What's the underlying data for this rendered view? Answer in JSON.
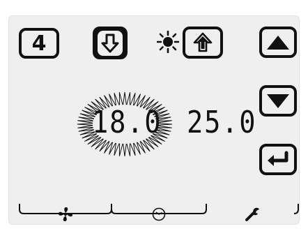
{
  "zone": {
    "number": "4"
  },
  "modes": {
    "heat_icon": "down-arrow-icon",
    "sun_icon": "sun-icon",
    "cool_icon": "up-arrow-icon"
  },
  "temperatures": {
    "setpoint_active": "18.0",
    "setpoint_other": "25.0"
  },
  "buttons": {
    "up_icon": "triangle-up-icon",
    "down_icon": "triangle-down-icon",
    "enter_icon": "enter-arrow-icon"
  },
  "tabs": [
    {
      "id": "fan",
      "icon": "fan-icon",
      "active": false
    },
    {
      "id": "clock",
      "icon": "clock-icon",
      "active": false
    },
    {
      "id": "wrench",
      "icon": "wrench-icon",
      "active": true
    }
  ],
  "colors": {
    "background": "#efefef",
    "foreground": "#111111"
  }
}
